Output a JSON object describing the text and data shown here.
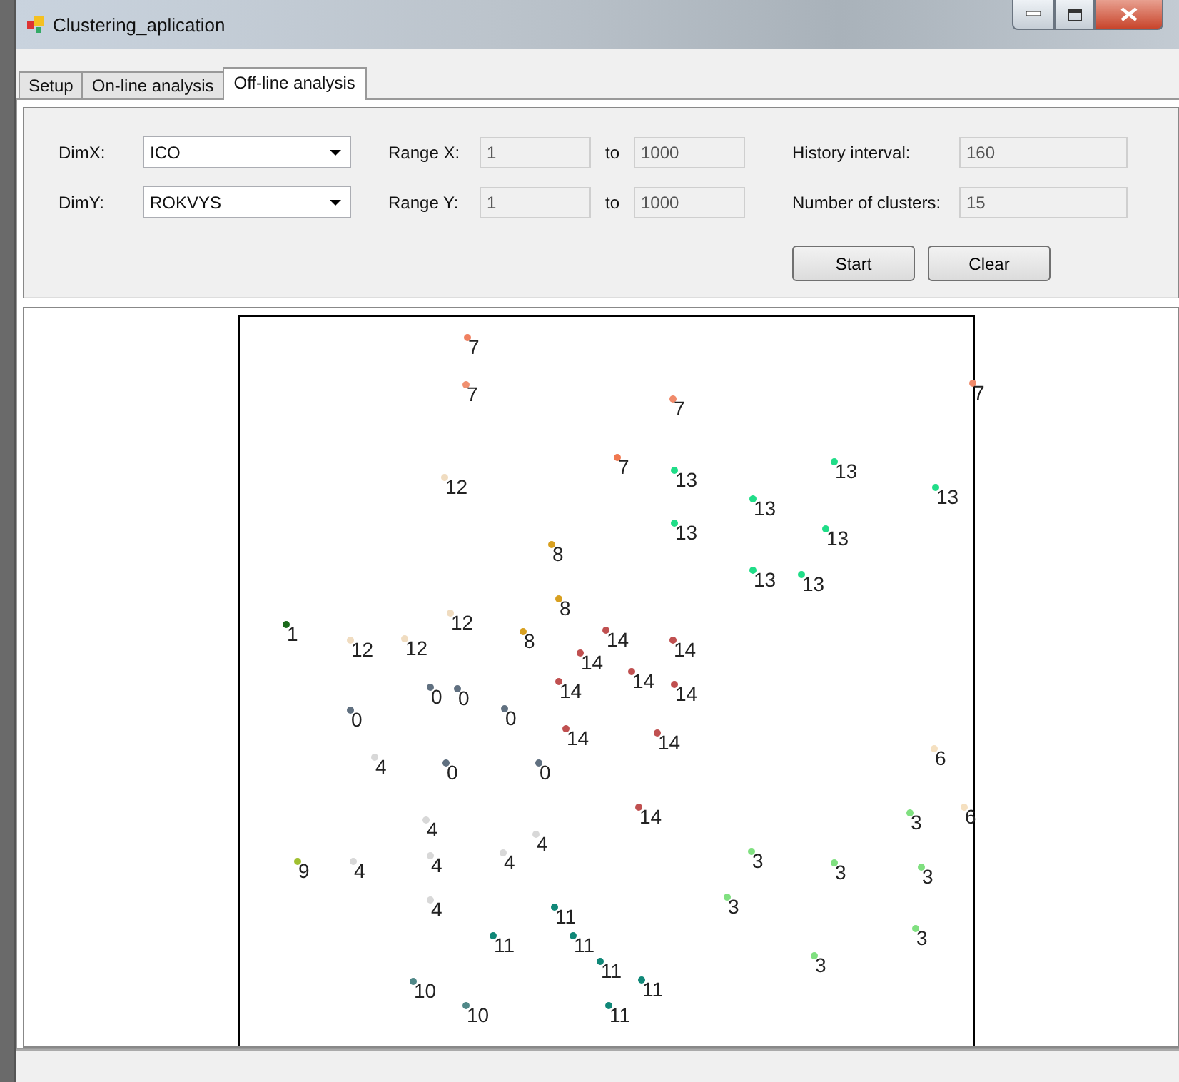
{
  "window": {
    "title": "Clustering_aplication"
  },
  "tabs": [
    {
      "label": "Setup",
      "selected": false
    },
    {
      "label": "On-line analysis",
      "selected": false
    },
    {
      "label": "Off-line analysis",
      "selected": true
    }
  ],
  "dims": [
    {
      "label": "DimX:",
      "value": "ICO"
    },
    {
      "label": "DimY:",
      "value": "ROKVYS"
    }
  ],
  "ranges": [
    {
      "label": "Range X:",
      "from": "1",
      "to_label": "to",
      "to": "1000",
      "disabled": true
    },
    {
      "label": "Range Y:",
      "from": "1",
      "to_label": "to",
      "to": "1000",
      "disabled": true
    }
  ],
  "params": [
    {
      "label": "History interval:",
      "value": "160",
      "disabled": true
    },
    {
      "label": "Number of clusters:",
      "value": "15",
      "disabled": true
    }
  ],
  "buttons": [
    "Start",
    "Clear"
  ],
  "plot": {
    "points": [
      {
        "label": "7",
        "color": "#f08060"
      },
      {
        "label": "7",
        "color": "#f09070"
      },
      {
        "label": "7",
        "color": "#f08a6a"
      },
      {
        "label": "7",
        "color": "#f08a6a"
      },
      {
        "label": "7",
        "color": "#f07850"
      },
      {
        "label": "12",
        "color": "#f0dcc0"
      },
      {
        "label": "13",
        "color": "#20dd88"
      },
      {
        "label": "13",
        "color": "#20dd88"
      },
      {
        "label": "13",
        "color": "#20dd88"
      },
      {
        "label": "13",
        "color": "#20dd88"
      },
      {
        "label": "13",
        "color": "#20dd88"
      },
      {
        "label": "13",
        "color": "#20dd88"
      },
      {
        "label": "8",
        "color": "#d8a020"
      },
      {
        "label": "13",
        "color": "#20dd88"
      },
      {
        "label": "13",
        "color": "#20dd88"
      },
      {
        "label": "8",
        "color": "#d8a020"
      },
      {
        "label": "1",
        "color": "#1a6a1a"
      },
      {
        "label": "12",
        "color": "#f0dcc0"
      },
      {
        "label": "12",
        "color": "#f0dcc0"
      },
      {
        "label": "12",
        "color": "#f0dcc0"
      },
      {
        "label": "8",
        "color": "#d8a020"
      },
      {
        "label": "14",
        "color": "#c05050"
      },
      {
        "label": "14",
        "color": "#c05050"
      },
      {
        "label": "14",
        "color": "#c05050"
      },
      {
        "label": "14",
        "color": "#c05050"
      },
      {
        "label": "0",
        "color": "#607080"
      },
      {
        "label": "0",
        "color": "#607080"
      },
      {
        "label": "14",
        "color": "#c05050"
      },
      {
        "label": "14",
        "color": "#c05050"
      },
      {
        "label": "0",
        "color": "#607080"
      },
      {
        "label": "0",
        "color": "#607080"
      },
      {
        "label": "14",
        "color": "#c05050"
      },
      {
        "label": "14",
        "color": "#c05050"
      },
      {
        "label": "4",
        "color": "#d8d8d8"
      },
      {
        "label": "0",
        "color": "#607080"
      },
      {
        "label": "0",
        "color": "#607080"
      },
      {
        "label": "6",
        "color": "#f5e0c0"
      },
      {
        "label": "14",
        "color": "#c05050"
      },
      {
        "label": "3",
        "color": "#80e080"
      },
      {
        "label": "6",
        "color": "#f5e0c0"
      },
      {
        "label": "4",
        "color": "#d8d8d8"
      },
      {
        "label": "4",
        "color": "#d8d8d8"
      },
      {
        "label": "9",
        "color": "#a0c030"
      },
      {
        "label": "4",
        "color": "#d8d8d8"
      },
      {
        "label": "4",
        "color": "#d8d8d8"
      },
      {
        "label": "4",
        "color": "#d8d8d8"
      },
      {
        "label": "3",
        "color": "#80e080"
      },
      {
        "label": "3",
        "color": "#80e080"
      },
      {
        "label": "3",
        "color": "#80e080"
      },
      {
        "label": "4",
        "color": "#d8d8d8"
      },
      {
        "label": "11",
        "color": "#108878"
      },
      {
        "label": "3",
        "color": "#80e080"
      },
      {
        "label": "3",
        "color": "#80e080"
      },
      {
        "label": "11",
        "color": "#108878"
      },
      {
        "label": "11",
        "color": "#108878"
      },
      {
        "label": "11",
        "color": "#108878"
      },
      {
        "label": "3",
        "color": "#80e080"
      },
      {
        "label": "10",
        "color": "#508888"
      },
      {
        "label": "11",
        "color": "#108878"
      },
      {
        "label": "10",
        "color": "#508888"
      },
      {
        "label": "11",
        "color": "#108878"
      }
    ]
  }
}
